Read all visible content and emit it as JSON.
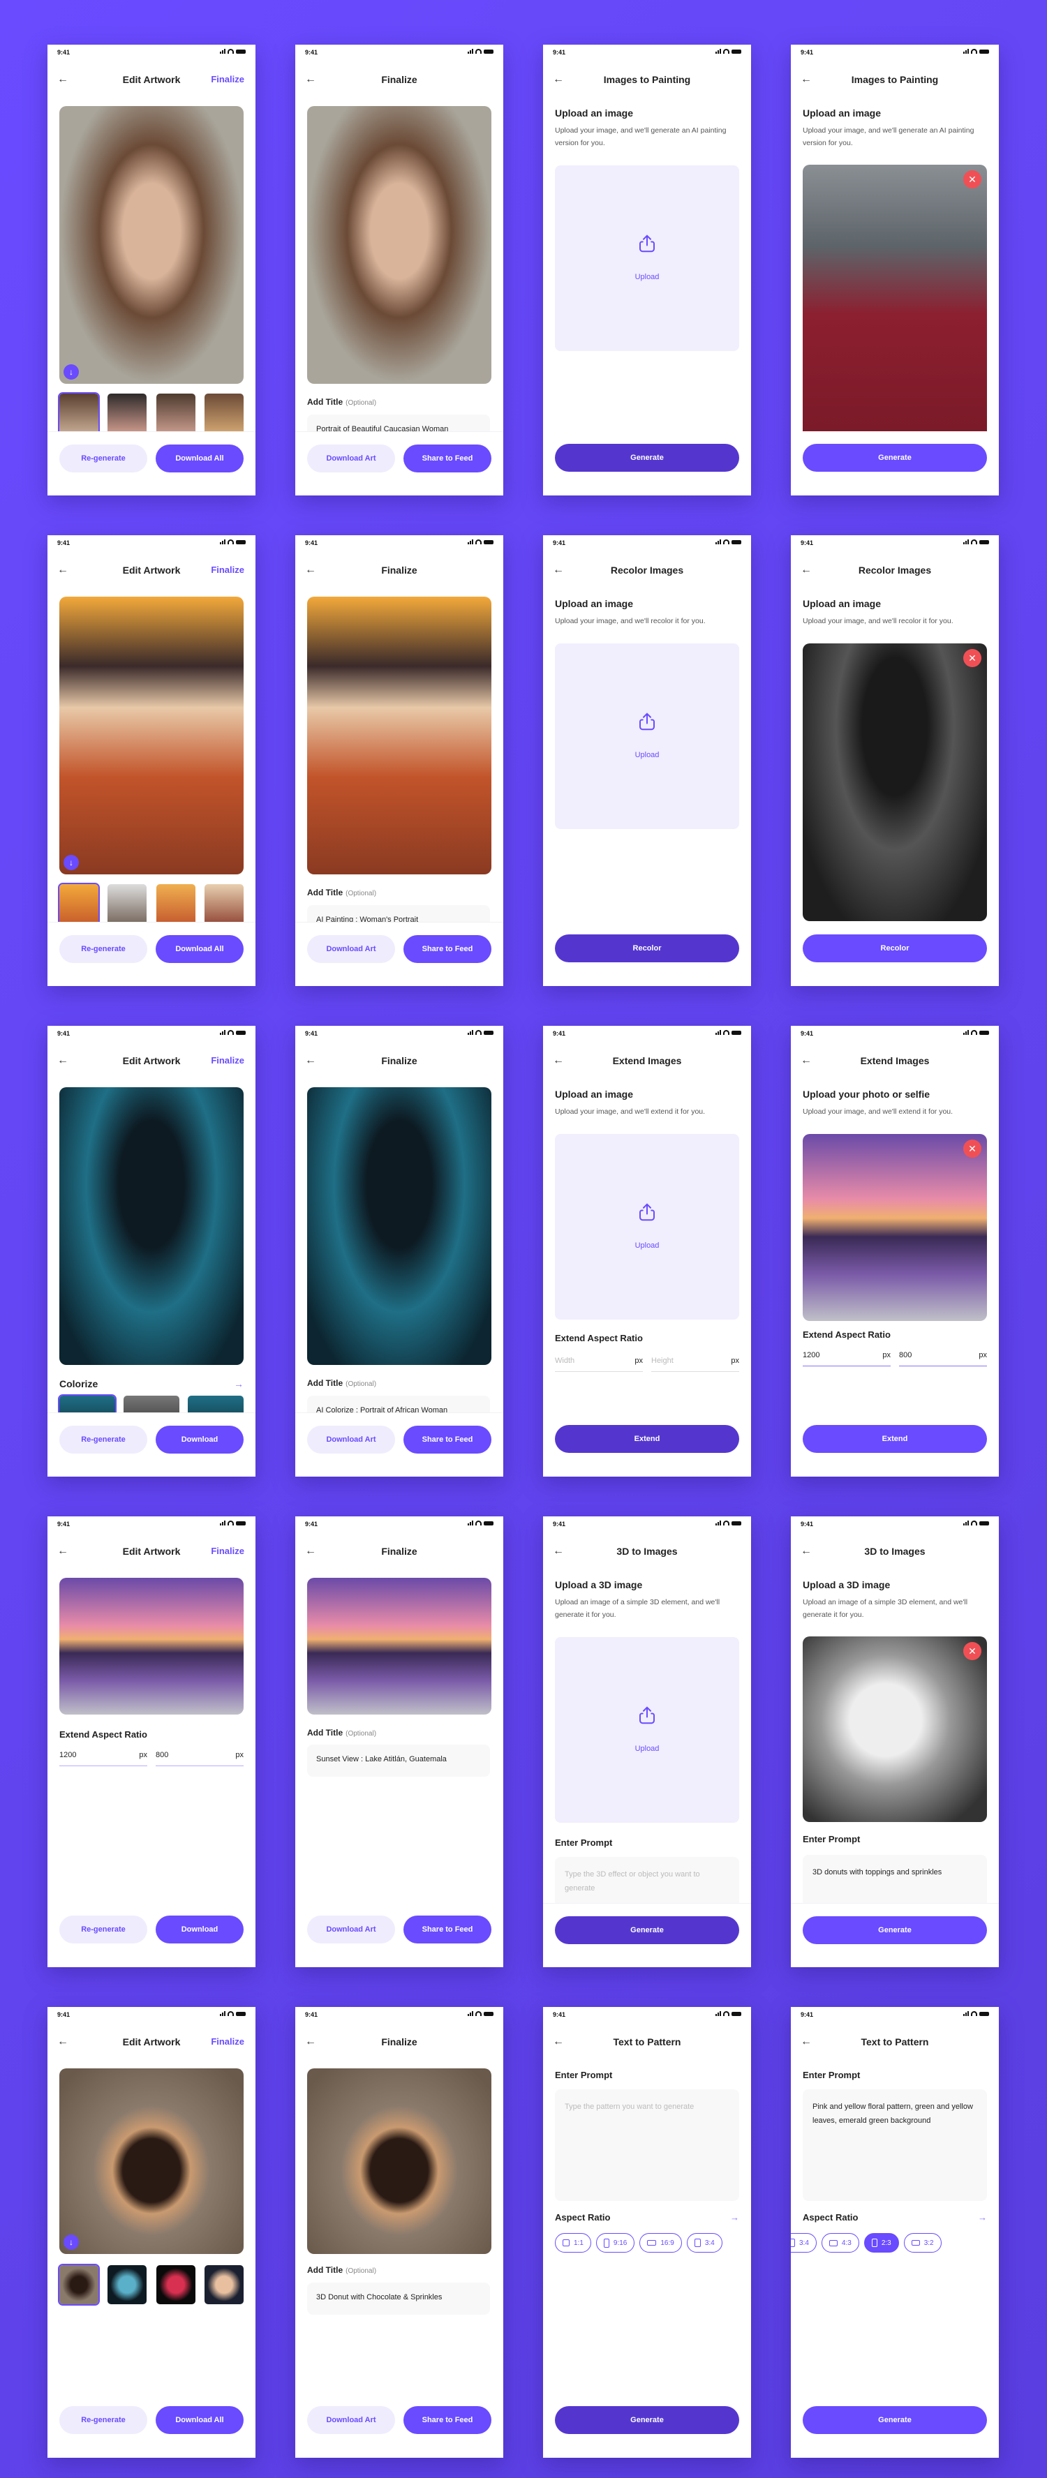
{
  "status": {
    "time": "9:41"
  },
  "common": {
    "back": "←",
    "finalize": "Finalize",
    "edit_title": "Edit Artwork",
    "finalize_title": "Finalize",
    "regenerate": "Re-generate",
    "download_all": "Download All",
    "download": "Download",
    "download_art": "Download Art",
    "share": "Share to Feed",
    "add_title": "Add Title",
    "optional": "(Optional)",
    "upload": "Upload",
    "close": "✕",
    "down_arrow": "↓",
    "right_arrow": "→",
    "px": "px"
  },
  "colors": {
    "accent": "#6a4bff",
    "accent_light": "#efecfd",
    "danger": "#f05055"
  },
  "painting": {
    "title": "Images to Painting",
    "heading": "Upload an image",
    "desc": "Upload your image, and we'll generate an AI painting version for you.",
    "button": "Generate",
    "final_title_1": "Portrait of Beautiful Caucasian Woman",
    "final_title_2": "AI Painting : Woman's Portrait"
  },
  "recolor": {
    "title": "Recolor Images",
    "heading": "Upload an image",
    "desc": "Upload your image, and we'll recolor it for you.",
    "button": "Recolor",
    "section": "Colorize",
    "final_title": "AI Colorize : Portrait of African Woman"
  },
  "extend": {
    "title": "Extend Images",
    "heading": "Upload an image",
    "heading_filled": "Upload your photo or selfie",
    "desc": "Upload your image, and we'll extend it for you.",
    "aspect": "Extend Aspect Ratio",
    "width_placeholder": "Width",
    "height_placeholder": "Height",
    "width_value": "1200",
    "height_value": "800",
    "button": "Extend",
    "final_title": "Sunset View : Lake Atitlán, Guatemala"
  },
  "threed": {
    "title": "3D to Images",
    "heading": "Upload a 3D image",
    "desc": "Upload an image of a simple 3D element, and we'll generate it for you.",
    "prompt_label": "Enter Prompt",
    "prompt_placeholder": "Type the 3D effect or object you want to generate",
    "prompt_value": "3D donuts with toppings and sprinkles",
    "button": "Generate",
    "final_title": "3D Donut with Chocolate & Sprinkles"
  },
  "pattern": {
    "title": "Text to Pattern",
    "prompt_label": "Enter Prompt",
    "prompt_placeholder": "Type the pattern you want to generate",
    "prompt_value": "Pink and yellow floral pattern, green and yellow leaves, emerald green background",
    "aspect_label": "Aspect Ratio",
    "ratios_a": [
      "1:1",
      "9:16",
      "16:9",
      "3:4"
    ],
    "ratios_b": [
      "3:4",
      "4:3",
      "2:3",
      "3:2"
    ],
    "selected_ratio": "2:3",
    "button": "Generate"
  }
}
